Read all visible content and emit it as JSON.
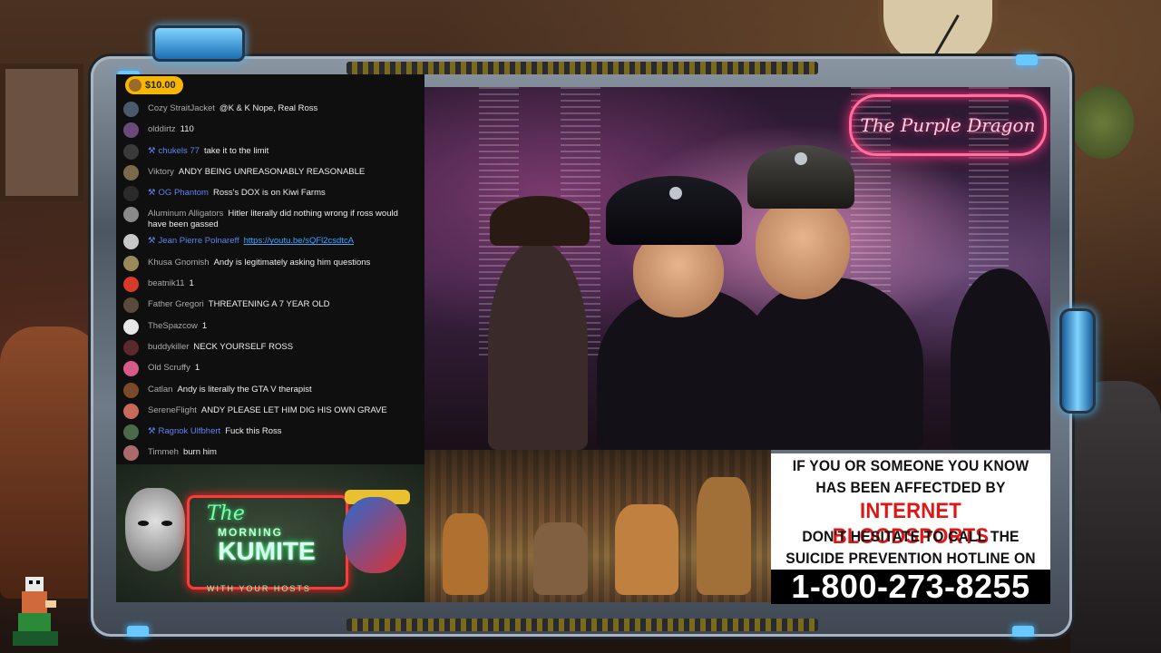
{
  "superchat": {
    "amount": "$10.00"
  },
  "chat": {
    "messages": [
      {
        "name": "Cozy StraitJacket",
        "text": "@K & K Nope, Real Ross",
        "mod": false,
        "avatar_color": "#4a5a6a"
      },
      {
        "name": "olddirtz",
        "text": "110",
        "mod": false,
        "avatar_color": "#6a4a7a"
      },
      {
        "name": "chukels 77",
        "text": "take it to the limit",
        "mod": true,
        "avatar_color": "#3a3a3a"
      },
      {
        "name": "Viktory",
        "text": "ANDY BEING UNREASONABLY REASONABLE",
        "mod": false,
        "avatar_color": "#7a6a4a"
      },
      {
        "name": "OG Phantom",
        "text": "Ross's DOX is on Kiwi Farms",
        "mod": true,
        "avatar_color": "#2a2a2a"
      },
      {
        "name": "Aluminum Alligators",
        "text": "Hitler literally did nothing wrong if ross would have been gassed",
        "mod": false,
        "avatar_color": "#8a8a8a"
      },
      {
        "name": "Jean Pierre Polnareff",
        "text": "https://youtu.be/sQFl2csdtcA",
        "mod": true,
        "link": true,
        "avatar_color": "#c8c8c8"
      },
      {
        "name": "Khusa Gnomish",
        "text": "Andy is legitimately asking him questions",
        "mod": false,
        "avatar_color": "#9a8a5a"
      },
      {
        "name": "beatnik11",
        "text": "1",
        "mod": false,
        "avatar_color": "#d83a2a"
      },
      {
        "name": "Father Gregori",
        "text": "THREATENING A 7 YEAR OLD",
        "mod": false,
        "avatar_color": "#5a4a3a"
      },
      {
        "name": "TheSpazcow",
        "text": "1",
        "mod": false,
        "avatar_color": "#e8e8e8"
      },
      {
        "name": "buddykiller",
        "text": "NECK YOURSELF ROSS",
        "mod": false,
        "avatar_color": "#5a2a2a"
      },
      {
        "name": "Old Scruffy",
        "text": "1",
        "mod": false,
        "avatar_color": "#d85a8a"
      },
      {
        "name": "Catlan",
        "text": "Andy is literally the GTA V therapist",
        "mod": false,
        "avatar_color": "#7a4a2a"
      },
      {
        "name": "SereneFlight",
        "text": "ANDY PLEASE LET HIM DIG HIS OWN GRAVE",
        "mod": false,
        "avatar_color": "#c86a5a"
      },
      {
        "name": "Ragnok Ulfbhert",
        "text": "Fuck this Ross",
        "mod": true,
        "avatar_color": "#4a6a4a"
      },
      {
        "name": "Timmeh",
        "text": "burn him",
        "mod": false,
        "avatar_color": "#a86a6a"
      }
    ]
  },
  "video": {
    "sign": "The Purple Dragon"
  },
  "logo": {
    "the": "The",
    "morning": "MORNING",
    "kumite": "KUMITE",
    "sub": "WITH YOUR HOSTS"
  },
  "psa": {
    "line1": "IF YOU OR SOMEONE YOU KNOW",
    "line2": "HAS BEEN AFFECTDED BY",
    "line3": "INTERNET BLOODSPORTS",
    "line4": "DON'T HESITATE TO CALL THE",
    "line5": "SUICIDE PREVENTION HOTLINE ON",
    "phone": "1-800-273-8255"
  },
  "icons": {
    "mod": "wrench-icon",
    "superchat_avatar": "avatar-icon"
  },
  "colors": {
    "chat_bg": "#0f0f0f",
    "mod_name": "#5e84f1",
    "link": "#3ea6ff",
    "superchat": "#f7b600",
    "psa_red": "#e21515"
  }
}
